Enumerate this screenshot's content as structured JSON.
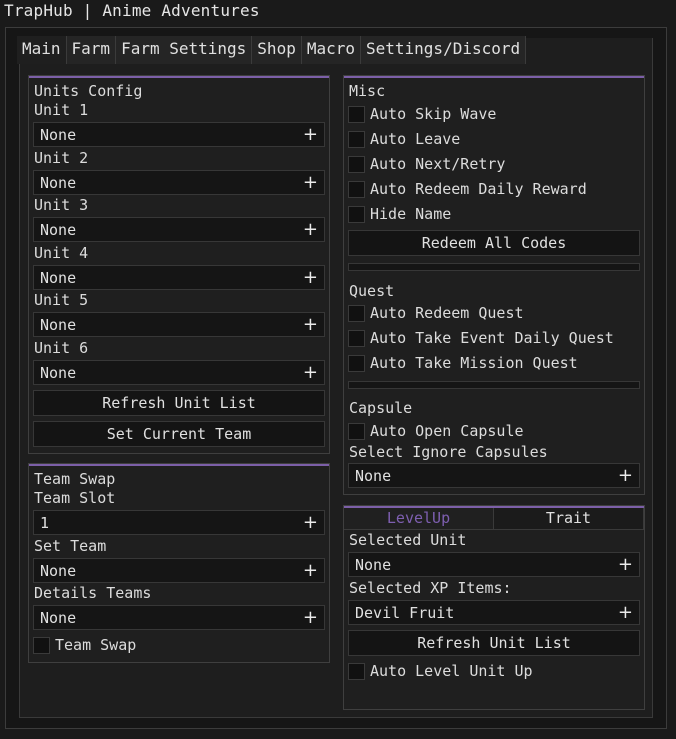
{
  "window": {
    "title": "TrapHub | Anime Adventures"
  },
  "tabs": [
    "Main",
    "Farm",
    "Farm Settings",
    "Shop",
    "Macro",
    "Settings/Discord"
  ],
  "units_config": {
    "title": "Units Config",
    "units": [
      {
        "label": "Unit 1",
        "value": "None"
      },
      {
        "label": "Unit 2",
        "value": "None"
      },
      {
        "label": "Unit 3",
        "value": "None"
      },
      {
        "label": "Unit 4",
        "value": "None"
      },
      {
        "label": "Unit 5",
        "value": "None"
      },
      {
        "label": "Unit 6",
        "value": "None"
      }
    ],
    "refresh_button": "Refresh Unit List",
    "set_team_button": "Set Current Team"
  },
  "team_swap": {
    "title": "Team Swap",
    "team_slot_label": "Team Slot",
    "team_slot_value": "1",
    "set_team_label": "Set Team",
    "set_team_value": "None",
    "details_label": "Details Teams",
    "details_value": "None",
    "toggle_label": "Team Swap"
  },
  "misc": {
    "title": "Misc",
    "toggles": [
      "Auto Skip Wave",
      "Auto Leave",
      "Auto Next/Retry",
      "Auto Redeem Daily Reward",
      "Hide Name"
    ],
    "redeem_button": "Redeem All Codes",
    "quest_label": "Quest",
    "quest_toggles": [
      "Auto Redeem Quest",
      "Auto Take Event Daily Quest",
      "Auto Take Mission Quest"
    ],
    "capsule_label": "Capsule",
    "capsule_toggle": "Auto Open Capsule",
    "ignore_label": "Select Ignore Capsules",
    "ignore_value": "None"
  },
  "levelup": {
    "tabs": [
      "LevelUp",
      "Trait"
    ],
    "selected_unit_label": "Selected Unit",
    "selected_unit_value": "None",
    "xp_label": "Selected XP Items:",
    "xp_value": "Devil Fruit",
    "refresh_button": "Refresh Unit List",
    "auto_toggle": "Auto Level Unit Up"
  },
  "colors": {
    "accent": "#7c5fa8",
    "background": "#1a1a1a",
    "panel": "#1f1f1f"
  },
  "icons": {
    "expand": "plus-icon"
  }
}
